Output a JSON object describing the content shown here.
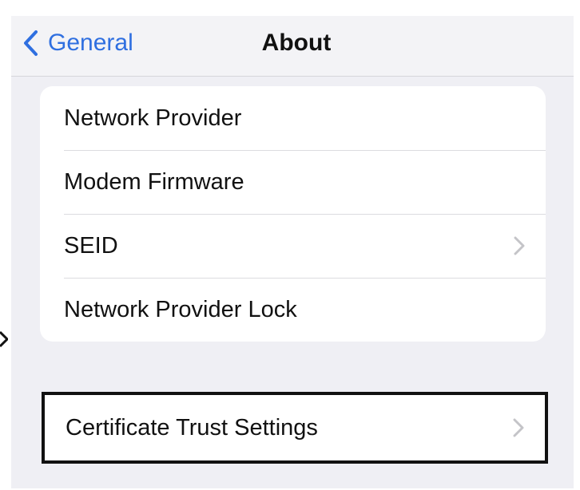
{
  "navbar": {
    "back_label": "General",
    "title": "About"
  },
  "about_items": [
    {
      "label": "Network Provider",
      "has_chevron": false
    },
    {
      "label": "Modem Firmware",
      "has_chevron": false
    },
    {
      "label": "SEID",
      "has_chevron": true
    },
    {
      "label": "Network Provider Lock",
      "has_chevron": false
    }
  ],
  "certificate": {
    "label": "Certificate Trust Settings"
  },
  "colors": {
    "accent": "#2f6fe0",
    "background": "#efeff4",
    "highlight_border": "#111111",
    "chevron": "#c4c4c8"
  },
  "icons": {
    "back": "chevron-left-icon",
    "disclosure": "chevron-right-icon",
    "pointer": "arrow-head-icon"
  }
}
